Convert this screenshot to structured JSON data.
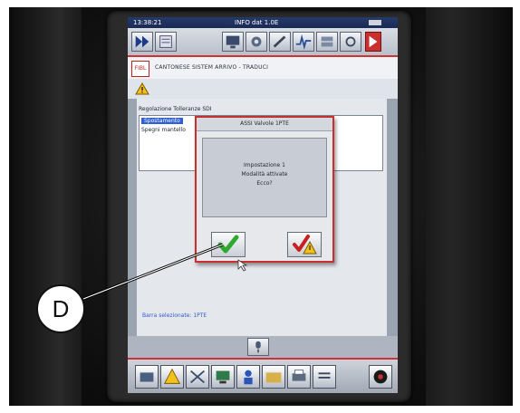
{
  "screen": {
    "top_bar": {
      "left_text": "13:38:21",
      "center_text": "INFO dat 1.0E"
    },
    "header": {
      "logo": "FIBL",
      "title": "CANTONESE SISTEM ARRIVO - TRADUCI"
    },
    "content": {
      "list_caption": "Regolazione Tolleranze SDI",
      "list_items": [
        "Spostamento",
        "Spegni mantello"
      ],
      "status_text": "Barra selezionate: 1PTE"
    },
    "dialog": {
      "title": "ASSI Valvole 1PTE",
      "message_lines": [
        "Impostazione 1",
        "Modalità attivate",
        "Ecco?"
      ]
    }
  },
  "annotation": {
    "callout_letter": "D"
  },
  "icons": {
    "confirm": "green-checkmark-icon",
    "cancel": "red-check-warning-icon",
    "warning": "warning-triangle-icon"
  },
  "colors": {
    "accent_red": "#c83030",
    "selection_blue": "#2f5fd0",
    "confirm_green": "#2fa82f"
  }
}
